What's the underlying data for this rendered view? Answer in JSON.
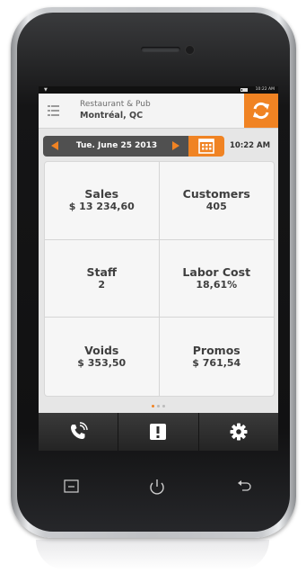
{
  "header": {
    "business_name": "Restaurant & Pub",
    "business_city": "Montréal, QC"
  },
  "statusbar": {
    "time": "10:22 AM"
  },
  "datebar": {
    "date": "Tue. June 25 2013",
    "time": "10:22 AM"
  },
  "tiles": [
    {
      "label": "Sales",
      "value": "$ 13 234,60"
    },
    {
      "label": "Customers",
      "value": "405"
    },
    {
      "label": "Staff",
      "value": "2"
    },
    {
      "label": "Labor Cost",
      "value": "18,61%"
    },
    {
      "label": "Voids",
      "value": "$ 353,50"
    },
    {
      "label": "Promos",
      "value": "$ 761,54"
    }
  ],
  "pager": {
    "pages": 3,
    "current": 1
  },
  "colors": {
    "accent": "#f08323",
    "toolbar": "#2e2e2e"
  },
  "icons": {
    "menu": "list-icon",
    "refresh": "refresh-icon",
    "calendar": "calendar-icon",
    "phone": "phone-icon",
    "alert": "alert-icon",
    "settings": "gear-icon"
  }
}
